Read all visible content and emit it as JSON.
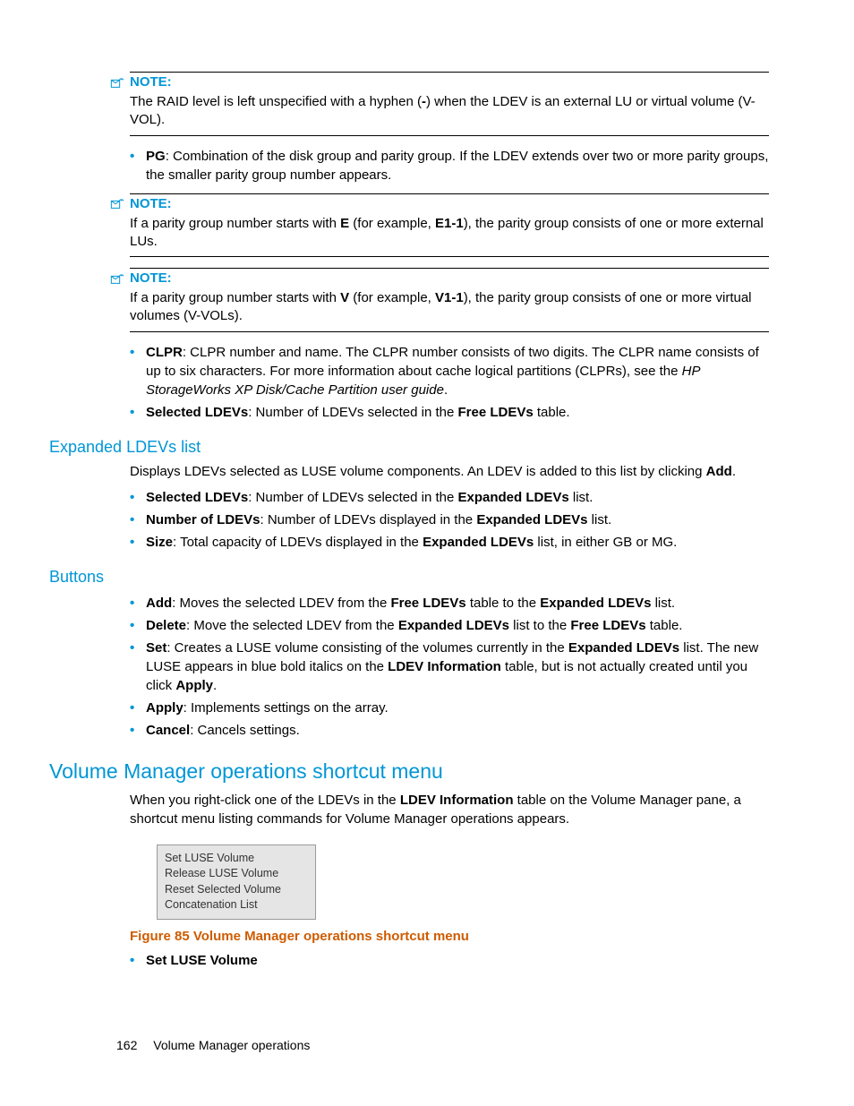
{
  "notes": [
    {
      "label": "NOTE:",
      "body_parts": [
        "The RAID level is left unspecified with a hyphen (",
        "-",
        ") when the LDEV is an external LU or virtual volume (V-VOL)."
      ]
    },
    {
      "label": "NOTE:",
      "body_parts": [
        "If a parity group number starts with ",
        "E",
        " (for example, ",
        "E1-1",
        "), the parity group consists of one or more external LUs."
      ]
    },
    {
      "label": "NOTE:",
      "body_parts": [
        "If a parity group number starts with ",
        "V",
        " (for example, ",
        "V1-1",
        "), the parity group consists of one or more virtual volumes (V-VOLs)."
      ]
    }
  ],
  "pg_bullet": {
    "label": "PG",
    "text": ": Combination of the disk group and parity group. If the LDEV extends over two or more parity groups, the smaller parity group number appears."
  },
  "post_note_bullets": [
    {
      "segments": [
        {
          "t": "CLPR",
          "b": true
        },
        {
          "t": ": CLPR number and name. The CLPR number consists of two digits. The CLPR name consists of up to six characters. For more information about cache logical partitions (CLPRs), see the "
        },
        {
          "t": "HP StorageWorks XP Disk/Cache Partition user guide",
          "i": true
        },
        {
          "t": "."
        }
      ]
    },
    {
      "segments": [
        {
          "t": "Selected LDEVs",
          "b": true
        },
        {
          "t": ": Number of LDEVs selected in the "
        },
        {
          "t": "Free LDEVs",
          "b": true
        },
        {
          "t": " table."
        }
      ]
    }
  ],
  "expanded": {
    "heading": "Expanded LDEVs list",
    "intro_segments": [
      {
        "t": "Displays LDEVs selected as LUSE volume components. An LDEV is added to this list by clicking "
      },
      {
        "t": "Add",
        "b": true
      },
      {
        "t": "."
      }
    ],
    "bullets": [
      [
        {
          "t": "Selected LDEVs",
          "b": true
        },
        {
          "t": ": Number of LDEVs selected in the "
        },
        {
          "t": "Expanded LDEVs",
          "b": true
        },
        {
          "t": " list."
        }
      ],
      [
        {
          "t": "Number of LDEVs",
          "b": true
        },
        {
          "t": ": Number of LDEVs displayed in the "
        },
        {
          "t": "Expanded LDEVs",
          "b": true
        },
        {
          "t": " list."
        }
      ],
      [
        {
          "t": "Size",
          "b": true
        },
        {
          "t": ": Total capacity of LDEVs displayed in the "
        },
        {
          "t": "Expanded LDEVs",
          "b": true
        },
        {
          "t": " list, in either GB or MG."
        }
      ]
    ]
  },
  "buttons": {
    "heading": "Buttons",
    "bullets": [
      [
        {
          "t": "Add",
          "b": true
        },
        {
          "t": ": Moves the selected LDEV from the "
        },
        {
          "t": "Free LDEVs",
          "b": true
        },
        {
          "t": " table to the "
        },
        {
          "t": "Expanded LDEVs",
          "b": true
        },
        {
          "t": " list."
        }
      ],
      [
        {
          "t": "Delete",
          "b": true
        },
        {
          "t": ": Move the selected LDEV from the "
        },
        {
          "t": "Expanded LDEVs",
          "b": true
        },
        {
          "t": " list to the "
        },
        {
          "t": "Free LDEVs",
          "b": true
        },
        {
          "t": " table."
        }
      ],
      [
        {
          "t": "Set",
          "b": true
        },
        {
          "t": ": Creates a LUSE volume consisting of the volumes currently in the "
        },
        {
          "t": "Expanded LDEVs",
          "b": true
        },
        {
          "t": " list. The new LUSE appears in blue bold italics on the "
        },
        {
          "t": "LDEV Information",
          "b": true
        },
        {
          "t": " table, but is not actually created until you click "
        },
        {
          "t": "Apply",
          "b": true
        },
        {
          "t": "."
        }
      ],
      [
        {
          "t": "Apply",
          "b": true
        },
        {
          "t": ": Implements settings on the array."
        }
      ],
      [
        {
          "t": "Cancel",
          "b": true
        },
        {
          "t": ": Cancels settings."
        }
      ]
    ]
  },
  "vm": {
    "heading": "Volume Manager operations shortcut menu",
    "intro_segments": [
      {
        "t": "When you right-click one of the LDEVs in the "
      },
      {
        "t": "LDEV Information",
        "b": true
      },
      {
        "t": " table on the Volume Manager pane, a shortcut menu listing commands for Volume Manager operations appears."
      }
    ],
    "menu_items": [
      "Set LUSE Volume",
      "Release LUSE Volume",
      "Reset Selected Volume",
      "Concatenation List"
    ],
    "figure_caption": "Figure 85 Volume Manager operations shortcut menu",
    "bullets": [
      [
        {
          "t": "Set LUSE Volume",
          "b": true
        }
      ]
    ]
  },
  "footer": {
    "page": "162",
    "title": "Volume Manager operations"
  }
}
